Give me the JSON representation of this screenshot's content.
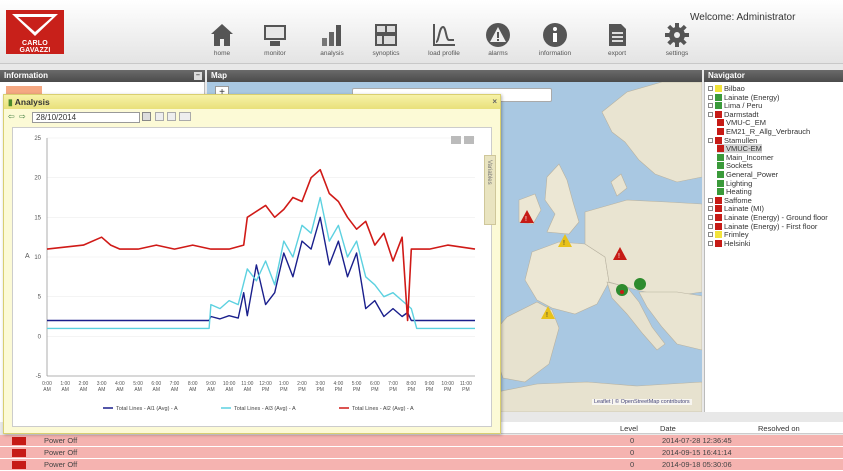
{
  "header": {
    "brand": "CARLO GAVAZZI",
    "welcome": "Welcome: Administrator",
    "tools": [
      {
        "label": "home",
        "icon": "home-icon"
      },
      {
        "label": "monitor",
        "icon": "monitor-icon"
      },
      {
        "label": "analysis",
        "icon": "bar-chart-icon"
      },
      {
        "label": "synoptics",
        "icon": "synoptics-icon"
      },
      {
        "label": "load profile",
        "icon": "load-profile-icon"
      },
      {
        "label": "alarms",
        "icon": "alarm-icon"
      },
      {
        "label": "information",
        "icon": "info-icon"
      },
      {
        "label": "export",
        "icon": "export-icon"
      },
      {
        "label": "settings",
        "icon": "gear-icon"
      }
    ]
  },
  "panels": {
    "information": "Information",
    "map": "Map",
    "navigator": "Navigator"
  },
  "map": {
    "attribution": "Leaflet | © OpenStreetMap contributors"
  },
  "navigator": {
    "items": [
      {
        "label": "Bilbao",
        "color": "#f2e33a",
        "level": 0,
        "expander": true
      },
      {
        "label": "Lainate (Energy)",
        "color": "#3a9a3a",
        "level": 0,
        "expander": true
      },
      {
        "label": "Lima / Peru",
        "color": "#3a9a3a",
        "level": 0,
        "expander": true
      },
      {
        "label": "Darmstadt",
        "color": "#c61b16",
        "level": 0,
        "expander": true
      },
      {
        "label": "VMU-C_EM",
        "color": "#c61b16",
        "level": 1,
        "expander": false
      },
      {
        "label": "EM21_R_Allg_Verbrauch",
        "color": "#c61b16",
        "level": 1,
        "expander": false
      },
      {
        "label": "Stamullen",
        "color": "#c61b16",
        "level": 0,
        "expander": true
      },
      {
        "label": "VMUC-EM",
        "color": "#c61b16",
        "level": 1,
        "expander": false,
        "selected": true
      },
      {
        "label": "Main_Incomer",
        "color": "#3a9a3a",
        "level": 1,
        "expander": false
      },
      {
        "label": "Sockets",
        "color": "#3a9a3a",
        "level": 1,
        "expander": false
      },
      {
        "label": "General_Power",
        "color": "#3a9a3a",
        "level": 1,
        "expander": false
      },
      {
        "label": "Lighting",
        "color": "#3a9a3a",
        "level": 1,
        "expander": false
      },
      {
        "label": "Heating",
        "color": "#3a9a3a",
        "level": 1,
        "expander": false
      },
      {
        "label": "Saffome",
        "color": "#c61b16",
        "level": 0,
        "expander": true
      },
      {
        "label": "Lainate (MI)",
        "color": "#c61b16",
        "level": 0,
        "expander": true
      },
      {
        "label": "Lainate (Energy) - Ground floor",
        "color": "#c61b16",
        "level": 0,
        "expander": true
      },
      {
        "label": "Lainate (Energy) - First floor",
        "color": "#c61b16",
        "level": 0,
        "expander": true
      },
      {
        "label": "Frimley",
        "color": "#f2e33a",
        "level": 0,
        "expander": true
      },
      {
        "label": "Helsinki",
        "color": "#c61b16",
        "level": 0,
        "expander": true
      }
    ]
  },
  "alarms": {
    "columns": {
      "level": "Level",
      "date": "Date",
      "resolved": "Resolved on"
    },
    "rows": [
      {
        "text": "Power Off",
        "level": "0",
        "date": "2014-07-28 12:36:45",
        "resolved": ""
      },
      {
        "text": "Power Off",
        "level": "0",
        "date": "2014-09-15 16:41:14",
        "resolved": ""
      },
      {
        "text": "Power Off",
        "level": "0",
        "date": "2014-09-18 05:30:06",
        "resolved": ""
      }
    ]
  },
  "analysis": {
    "title": "Analysis",
    "date": "28/10/2014",
    "side_tab": "Variables"
  },
  "chart_data": {
    "type": "line",
    "ylabel": "A",
    "ylim": [
      -5,
      25
    ],
    "yticks": [
      -5,
      0,
      5,
      10,
      15,
      20,
      25
    ],
    "xlim": [
      0,
      23.5
    ],
    "xticks": [
      "0:00 AM",
      "1:00 AM",
      "2:00 AM",
      "3:00 AM",
      "4:00 AM",
      "5:00 AM",
      "6:00 AM",
      "7:00 AM",
      "8:00 AM",
      "9:00 AM",
      "10:00 AM",
      "11:00 AM",
      "12:00 PM",
      "1:00 PM",
      "2:00 PM",
      "3:00 PM",
      "4:00 PM",
      "5:00 PM",
      "6:00 PM",
      "7:00 PM",
      "8:00 PM",
      "9:00 PM",
      "10:00 PM",
      "11:00 PM"
    ],
    "series": [
      {
        "name": "Total Lines - Al1 (Avg) - A",
        "color": "#1a1f8c",
        "x": [
          0,
          8.9,
          9.0,
          9.5,
          10.0,
          10.5,
          10.8,
          11.0,
          11.5,
          12.0,
          12.5,
          13.0,
          13.5,
          14.0,
          14.5,
          15.0,
          15.5,
          16.0,
          16.5,
          17.0,
          17.5,
          18.0,
          18.5,
          19.0,
          19.5,
          19.8,
          20.0,
          23.5
        ],
        "y": [
          2.0,
          2.0,
          2.5,
          2.2,
          2.6,
          2.3,
          5.5,
          2.6,
          9.0,
          4.0,
          5.5,
          10.5,
          7.5,
          12.0,
          11.0,
          15.0,
          9.0,
          12.0,
          7.5,
          10.5,
          3.5,
          4.5,
          2.5,
          3.5,
          2.5,
          3.0,
          2.0,
          2.0
        ]
      },
      {
        "name": "Total Lines - Al3 (Avg) - A",
        "color": "#5cd1e0",
        "x": [
          0,
          8.9,
          9.0,
          9.5,
          10.0,
          10.5,
          11.0,
          11.5,
          12.0,
          12.5,
          13.0,
          13.5,
          14.0,
          14.5,
          15.0,
          15.5,
          16.0,
          16.5,
          17.0,
          17.5,
          18.0,
          18.5,
          19.0,
          19.5,
          20.0,
          20.3,
          23.5
        ],
        "y": [
          1.0,
          1.0,
          4.0,
          3.5,
          4.5,
          4.0,
          8.5,
          7.0,
          9.5,
          6.5,
          12.0,
          10.0,
          14.0,
          13.0,
          17.5,
          12.0,
          14.0,
          10.0,
          12.0,
          7.5,
          6.5,
          5.0,
          5.5,
          4.5,
          3.5,
          1.0,
          1.0
        ]
      },
      {
        "name": "Total Lines - Al2 (Avg) - A",
        "color": "#d01a17",
        "x": [
          0,
          2.0,
          3.0,
          3.5,
          4.0,
          5.0,
          6.0,
          7.0,
          8.0,
          9.0,
          10.0,
          10.8,
          11.0,
          12.0,
          12.5,
          13.0,
          13.5,
          14.0,
          14.5,
          15.0,
          15.5,
          16.0,
          16.5,
          17.0,
          17.5,
          18.0,
          18.5,
          19.0,
          19.5,
          19.8,
          20.0,
          21.0,
          22.0,
          23.5
        ],
        "y": [
          11.0,
          11.5,
          12.5,
          11.5,
          11.0,
          11.0,
          11.5,
          11.0,
          11.5,
          11.0,
          11.0,
          11.5,
          15.0,
          16.5,
          15.0,
          16.0,
          17.5,
          17.0,
          20.0,
          21.0,
          18.0,
          17.0,
          15.0,
          13.5,
          14.5,
          11.5,
          13.0,
          9.5,
          12.5,
          2.0,
          11.0,
          11.0,
          11.5,
          11.0
        ]
      }
    ],
    "legend_position": "bottom"
  }
}
